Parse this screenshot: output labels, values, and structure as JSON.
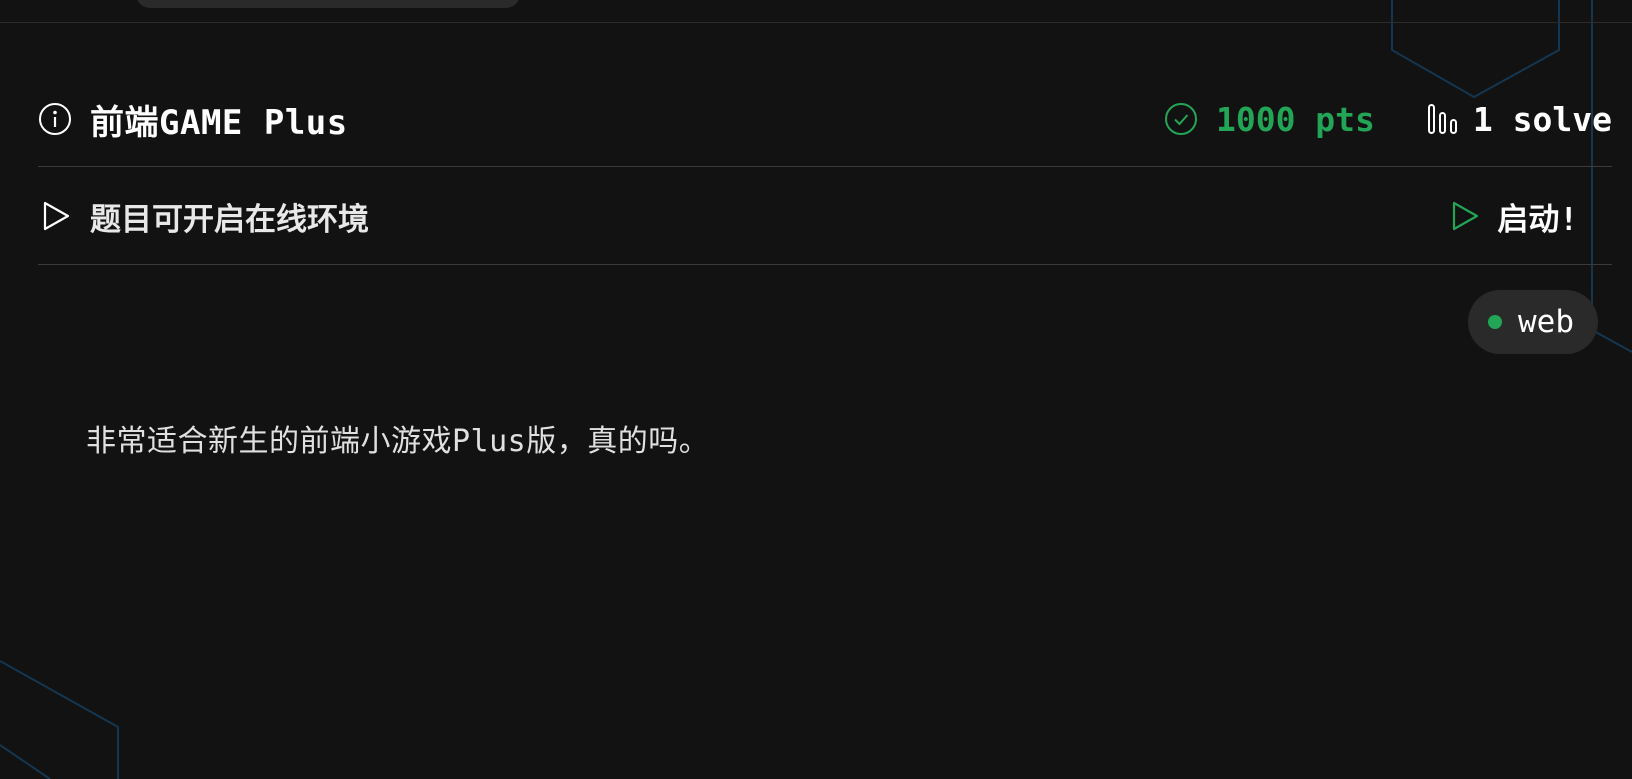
{
  "challenge": {
    "title": "前端GAME Plus",
    "points": "1000 pts",
    "solves": "1 solve",
    "category_tag": "web",
    "description": "非常适合新生的前端小游戏Plus版，真的吗。"
  },
  "environment": {
    "notice": "题目可开启在线环境",
    "launch_label": "启动!"
  },
  "colors": {
    "background": "#121212",
    "accent_green": "#22a556",
    "decor_blue": "#143651",
    "tag_background": "#2a2a2a"
  },
  "icons": {
    "title_icon": "info-icon",
    "points_icon": "check-circle-icon",
    "solves_icon": "bar-chart-icon",
    "env_icon": "play-icon",
    "launch_icon": "play-icon"
  }
}
